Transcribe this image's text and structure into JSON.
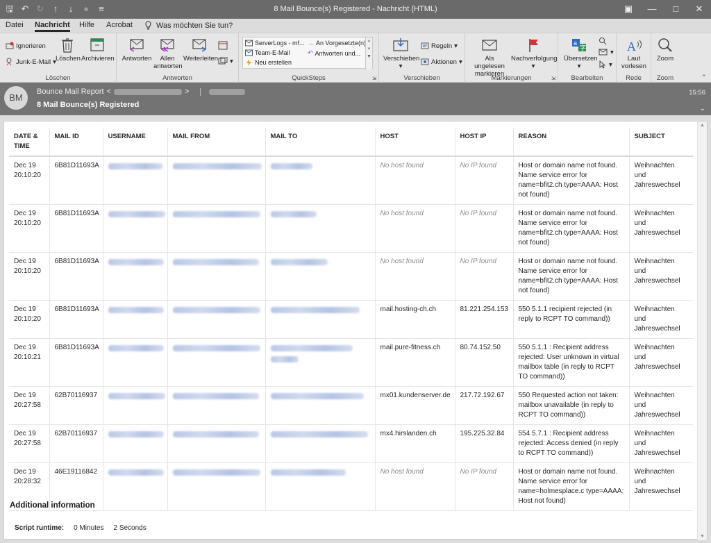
{
  "window": {
    "title": "8 Mail Bounce(s) Registered  -  Nachricht (HTML)"
  },
  "tabs": [
    "Datei",
    "Nachricht",
    "Hilfe",
    "Acrobat"
  ],
  "active_tab": "Nachricht",
  "tell_me": "Was möchten Sie tun?",
  "ribbon": {
    "loeschen": {
      "label": "Löschen",
      "ignore": "Ignorieren",
      "junk": "Junk-E-Mail",
      "delete": "Löschen",
      "archive": "Archivieren"
    },
    "antworten": {
      "label": "Antworten",
      "reply": "Antworten",
      "reply_all": "Allen antworten",
      "forward": "Weiterleiten"
    },
    "quicksteps": {
      "label": "QuickSteps",
      "items": [
        "ServerLogs - mf...",
        "Team-E-Mail",
        "Neu erstellen",
        "An Vorgesetzte(n)",
        "Antworten und..."
      ]
    },
    "verschieben": {
      "label": "Verschieben",
      "move": "Verschieben",
      "rules": "Regeln",
      "actions": "Aktionen"
    },
    "markierungen": {
      "label": "Markierungen",
      "mark_unread": "Als ungelesen markieren",
      "followup": "Nachverfolgung"
    },
    "bearbeiten": {
      "label": "Bearbeiten",
      "translate": "Übersetzen"
    },
    "rede": {
      "label": "Rede",
      "read_aloud": "Laut vorlesen"
    },
    "zoom": {
      "label": "Zoom",
      "zoom": "Zoom"
    }
  },
  "message": {
    "avatar_initials": "BM",
    "sender_name": "Bounce Mail Report",
    "subject": "8 Mail Bounce(s) Registered",
    "time": "15:56"
  },
  "table": {
    "headers": [
      "DATE & TIME",
      "MAIL ID",
      "USERNAME",
      "MAIL FROM",
      "MAIL TO",
      "HOST",
      "HOST IP",
      "REASON",
      "SUBJECT"
    ],
    "rows": [
      {
        "date": "Dec 19 20:10:20",
        "mail_id": "6B81D11693A",
        "host": "No host found",
        "host_ip": "No IP found",
        "reason": "Host or domain name not found. Name service error for name=bfit2.ch type=AAAA: Host not found)",
        "subject": "Weihnachten und Jahreswechsel"
      },
      {
        "date": "Dec 19 20:10:20",
        "mail_id": "6B81D11693A",
        "host": "No host found",
        "host_ip": "No IP found",
        "reason": "Host or domain name not found. Name service error for name=bfit2.ch type=AAAA: Host not found)",
        "subject": "Weihnachten und Jahreswechsel"
      },
      {
        "date": "Dec 19 20:10:20",
        "mail_id": "6B81D11693A",
        "host": "No host found",
        "host_ip": "No IP found",
        "reason": "Host or domain name not found. Name service error for name=bfit2.ch type=AAAA: Host not found)",
        "subject": "Weihnachten und Jahreswechsel"
      },
      {
        "date": "Dec 19 20:10:20",
        "mail_id": "6B81D11693A",
        "host": "mail.hosting-ch.ch",
        "host_ip": "81.221.254.153",
        "reason": "550 5.1.1 recipient rejected (in reply to RCPT TO command))",
        "subject": "Weihnachten und Jahreswechsel"
      },
      {
        "date": "Dec 19 20:10:21",
        "mail_id": "6B81D11693A",
        "host": "mail.pure-fitness.ch",
        "host_ip": "80.74.152.50",
        "reason": "550 5.1.1 : Recipient address rejected: User unknown in virtual mailbox table (in reply to RCPT TO command))",
        "subject": "Weihnachten und Jahreswechsel"
      },
      {
        "date": "Dec 19 20:27:58",
        "mail_id": "62B70116937",
        "host": "mx01.kundenserver.de",
        "host_ip": "217.72.192.67",
        "reason": "550 Requested action not taken: mailbox unavailable (in reply to RCPT TO command))",
        "subject": "Weihnachten und Jahreswechsel"
      },
      {
        "date": "Dec 19 20:27:58",
        "mail_id": "62B70116937",
        "host": "mx4.hirslanden.ch",
        "host_ip": "195.225.32.84",
        "reason": "554 5.7.1 : Recipient address rejected: Access denied (in reply to RCPT TO command))",
        "subject": "Weihnachten und Jahreswechsel"
      },
      {
        "date": "Dec 19 20:28:32",
        "mail_id": "46E19116842",
        "host": "No host found",
        "host_ip": "No IP found",
        "reason": "Host or domain name not found. Name service error for name=holmesplace.c type=AAAA: Host not found)",
        "subject": "Weihnachten und Jahreswechsel"
      }
    ]
  },
  "additional": {
    "heading": "Additional information",
    "runtime_label": "Script runtime:",
    "runtime_minutes": "0 Minutes",
    "runtime_seconds": "2 Seconds"
  }
}
